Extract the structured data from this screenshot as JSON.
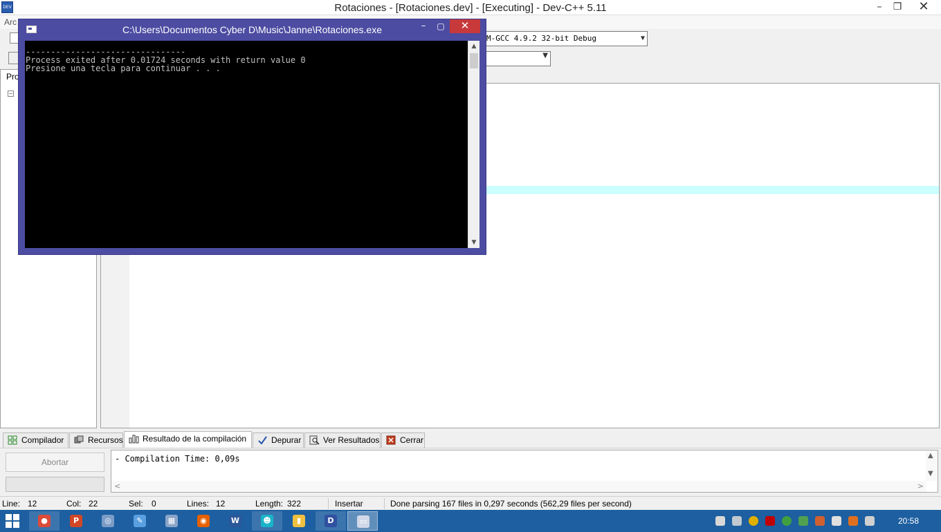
{
  "main_window": {
    "title": "Rotaciones - [Rotaciones.dev] - [Executing] - Dev-C++ 5.11",
    "icon_label": "DEV",
    "menu_partial": "Arc",
    "controls": {
      "minimize": "–",
      "maximize": "❐",
      "close": "✕"
    }
  },
  "toolbar": {
    "compiler_selected": "M-GCC 4.9.2 32-bit Debug",
    "dropdown_arrow": "▼"
  },
  "left_panel": {
    "tab_label": "Pro",
    "tree_expander": "−"
  },
  "console_window": {
    "title": "C:\\Users\\Documentos Cyber D\\Music\\Janne\\Rotaciones.exe",
    "controls": {
      "minimize": "–",
      "maximize": "▢",
      "close": "✕"
    },
    "output": "--------------------------------\nProcess exited after 0.01724 seconds with return value 0\nPresione una tecla para continuar . . .",
    "scroll_up": "▲",
    "scroll_down": "▼"
  },
  "bottom_tabs": [
    {
      "label": "Compilador"
    },
    {
      "label": "Recursos"
    },
    {
      "label": "Resultado de la compilación"
    },
    {
      "label": "Depurar"
    },
    {
      "label": "Ver Resultados"
    },
    {
      "label": "Cerrar"
    }
  ],
  "bottom_panel": {
    "abort_label": "Abortar",
    "log_text": "- Compilation Time: 0,09s",
    "scroll_up": "▲",
    "scroll_down": "▼",
    "scroll_left": "<",
    "scroll_right": ">"
  },
  "statusbar": {
    "line_label": "Line:",
    "line_value": "12",
    "col_label": "Col:",
    "col_value": "22",
    "sel_label": "Sel:",
    "sel_value": "0",
    "lines_label": "Lines:",
    "lines_value": "12",
    "length_label": "Length:",
    "length_value": "322",
    "mode": "Insertar",
    "message": "Done parsing 167 files in 0,297 seconds (562,29 files per second)"
  },
  "taskbar": {
    "apps": [
      {
        "name": "chrome",
        "glyph": "●",
        "color": "#dd4b39"
      },
      {
        "name": "powerpoint",
        "glyph": "P",
        "color": "#d24726"
      },
      {
        "name": "network-app",
        "glyph": "◎",
        "color": "#7a9cc6"
      },
      {
        "name": "paint-app",
        "glyph": "✎",
        "color": "#5aa0e0"
      },
      {
        "name": "calculator",
        "glyph": "▦",
        "color": "#8aa4c8"
      },
      {
        "name": "firefox",
        "glyph": "◉",
        "color": "#e66000"
      },
      {
        "name": "word",
        "glyph": "W",
        "color": "#2b579a"
      },
      {
        "name": "messenger-app",
        "glyph": "☻",
        "color": "#19b4c8"
      },
      {
        "name": "file-explorer",
        "glyph": "▮",
        "color": "#f0c040"
      },
      {
        "name": "devcpp",
        "glyph": "D",
        "color": "#3050a0"
      },
      {
        "name": "console-app",
        "glyph": "▭",
        "color": "#d0d8e8"
      }
    ],
    "clock": "20:58"
  }
}
